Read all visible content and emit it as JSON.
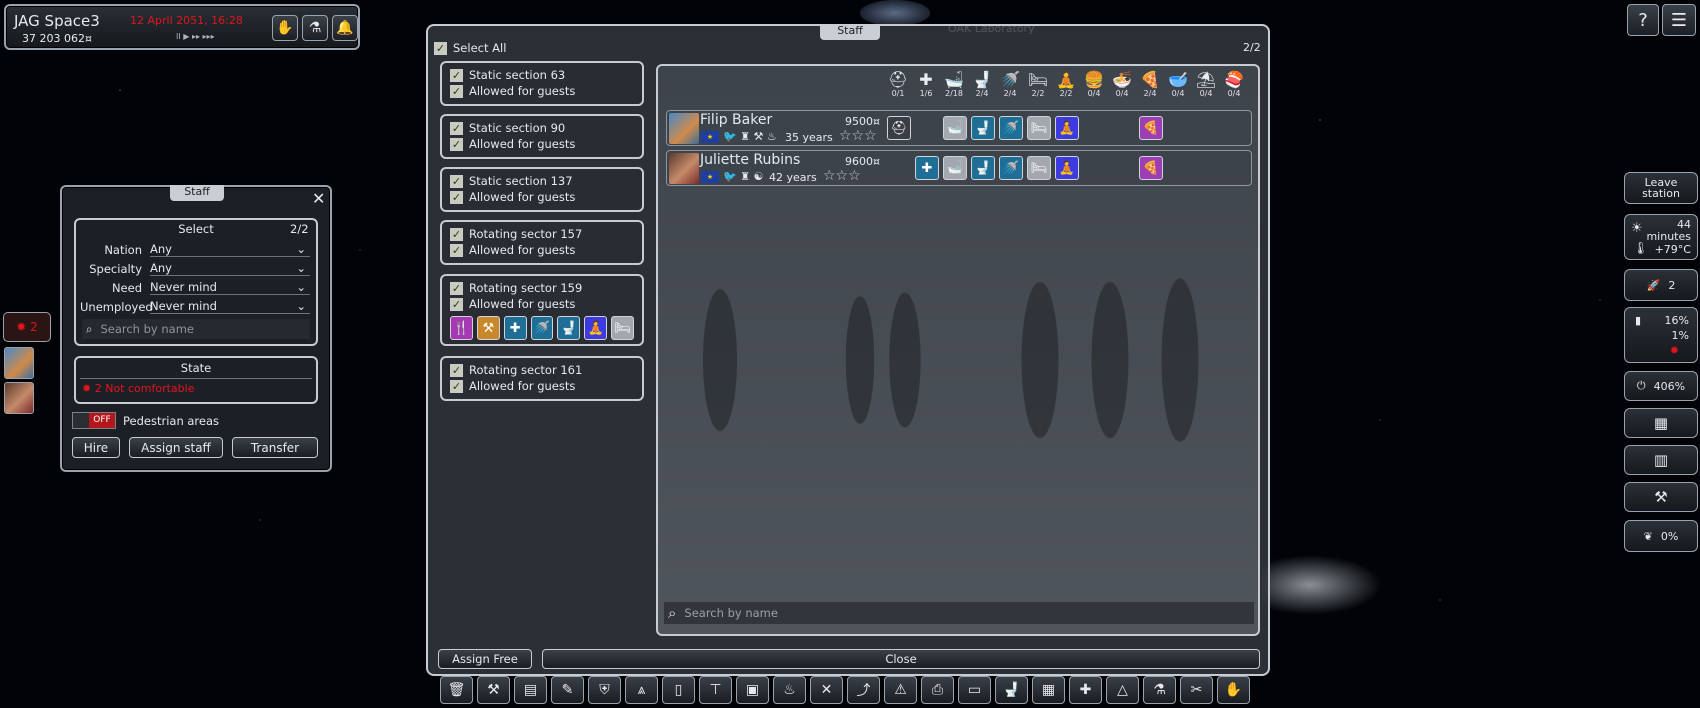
{
  "hud": {
    "station_name": "JAG Space3",
    "datetime": "12 April 2051, 16:28",
    "money": "37 203 062¤",
    "speed_controls": "II ▶ ▸▸ ▸▸▸"
  },
  "staff_small": {
    "title": "Staff",
    "select_label": "Select",
    "select_count": "2/2",
    "filters": [
      {
        "label": "Nation",
        "value": "Any"
      },
      {
        "label": "Specialty",
        "value": "Any"
      },
      {
        "label": "Need",
        "value": "Never mind"
      },
      {
        "label": "Unemployed",
        "value": "Never mind"
      }
    ],
    "search_placeholder": "Search by name",
    "state_title": "State",
    "state_value": "2  Not comfortable",
    "toggle_state": "OFF",
    "pedestrian_label": "Pedestrian areas",
    "buttons": {
      "hire": "Hire",
      "assign": "Assign staff",
      "transfer": "Transfer"
    }
  },
  "side_alert": {
    "count": "2"
  },
  "main_panel": {
    "title": "Staff",
    "page": "2/2",
    "select_all": "Select All",
    "sections": [
      {
        "name": "Static section 63",
        "guests": "Allowed for guests"
      },
      {
        "name": "Static section 90",
        "guests": "Allowed for guests"
      },
      {
        "name": "Static section 137",
        "guests": "Allowed for guests"
      },
      {
        "name": "Rotating sector 157",
        "guests": "Allowed for guests"
      },
      {
        "name": "Rotating sector 159",
        "guests": "Allowed for guests"
      },
      {
        "name": "Rotating sector 161",
        "guests": "Allowed for guests"
      }
    ],
    "header_icons": [
      {
        "icon": "helmet-icon",
        "glyph": "⛑",
        "count": "0/1"
      },
      {
        "icon": "medical-icon",
        "glyph": "✚",
        "count": "1/6"
      },
      {
        "icon": "bath-icon",
        "glyph": "🛁",
        "count": "2/18"
      },
      {
        "icon": "toilet-icon",
        "glyph": "🚽",
        "count": "2/4"
      },
      {
        "icon": "shower-icon",
        "glyph": "🚿",
        "count": "2/4"
      },
      {
        "icon": "bed-icon",
        "glyph": "🛏",
        "count": "2/2"
      },
      {
        "icon": "meditation-icon",
        "glyph": "🧘",
        "count": "2/2"
      },
      {
        "icon": "burger-icon",
        "glyph": "🍔",
        "count": "0/4"
      },
      {
        "icon": "noodles-icon",
        "glyph": "🍜",
        "count": "0/4"
      },
      {
        "icon": "pizza-icon",
        "glyph": "🍕",
        "count": "2/4"
      },
      {
        "icon": "bowl-icon",
        "glyph": "🥣",
        "count": "0/4"
      },
      {
        "icon": "lounger-icon",
        "glyph": "⛱",
        "count": "0/4"
      },
      {
        "icon": "sushi-icon",
        "glyph": "🍣",
        "count": "0/4"
      }
    ],
    "staff": [
      {
        "name": "Filip Baker",
        "salary": "9500¤",
        "age": "35 years",
        "stars": "☆☆☆"
      },
      {
        "name": "Juliette Rubins",
        "salary": "9600¤",
        "age": "42 years",
        "stars": "☆☆☆"
      }
    ],
    "search_placeholder": "Search by name",
    "assign_free": "Assign Free",
    "close": "Close",
    "ghost_title": "OAK Laboratory"
  },
  "right_hud": {
    "leave": "Leave station",
    "minutes": "44 minutes",
    "temp": "+79°C",
    "rockets": "2",
    "pct1": "16%",
    "pct2": "1%",
    "power": "406%",
    "oxygen": "0%"
  },
  "colors": {
    "alert_red": "#e0161b",
    "accent_purple": "#a63ab3",
    "accent_teal": "#1f6e95"
  }
}
